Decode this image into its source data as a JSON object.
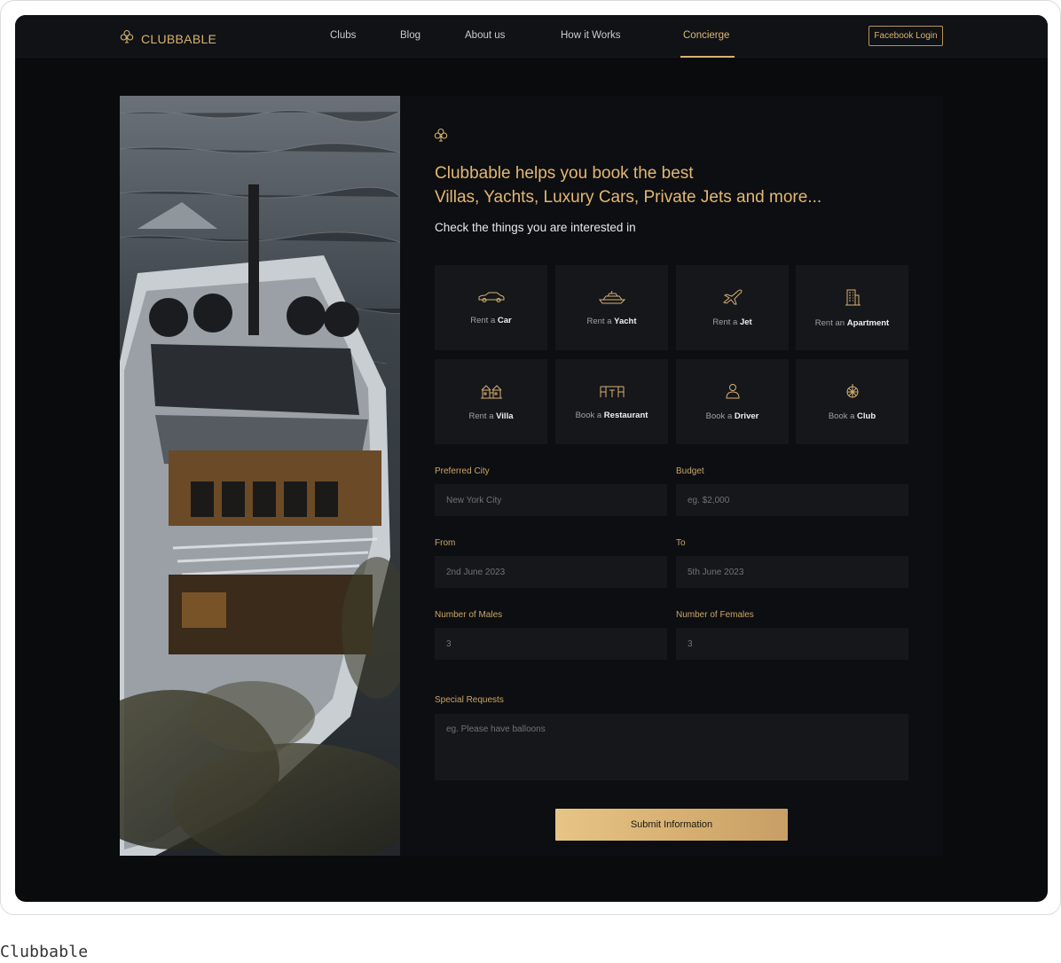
{
  "header": {
    "logo_text": "CLUBBABLE",
    "nav": [
      {
        "label": "Clubs"
      },
      {
        "label": "Blog"
      },
      {
        "label": "About us"
      },
      {
        "label": "How it Works"
      },
      {
        "label": "Concierge",
        "active": true
      }
    ],
    "facebook_login_label": "Facebook Login"
  },
  "panel": {
    "headline_line1": "Clubbable helps you book the best",
    "headline_line2": "Villas, Yachts, Luxury Cars, Private Jets and more...",
    "subline": "Check the things you are interested in",
    "tiles": [
      {
        "prefix": "Rent a",
        "item": "Car",
        "icon": "car-icon"
      },
      {
        "prefix": "Rent a",
        "item": "Yacht",
        "icon": "yacht-icon"
      },
      {
        "prefix": "Rent a",
        "item": "Jet",
        "icon": "jet-icon"
      },
      {
        "prefix": "Rent an",
        "item": "Apartment",
        "icon": "apartment-icon"
      },
      {
        "prefix": "Rent a",
        "item": "Villa",
        "icon": "villa-icon"
      },
      {
        "prefix": "Book a",
        "item": "Restaurant",
        "icon": "restaurant-icon"
      },
      {
        "prefix": "Book a",
        "item": "Driver",
        "icon": "driver-icon"
      },
      {
        "prefix": "Book a",
        "item": "Club",
        "icon": "club-icon"
      }
    ],
    "form": {
      "city_label": "Preferred City",
      "city_placeholder": "New York City",
      "budget_label": "Budget",
      "budget_placeholder": "eg. $2,000",
      "from_label": "From",
      "from_placeholder": "2nd June 2023",
      "to_label": "To",
      "to_placeholder": "5th June 2023",
      "males_label": "Number of Males",
      "males_placeholder": "3",
      "females_label": "Number of Females",
      "females_placeholder": "3",
      "requests_label": "Special Requests",
      "requests_placeholder": "eg. Please have balloons",
      "submit_label": "Submit Information"
    }
  },
  "caption": "Clubbable",
  "colors": {
    "accent": "#d9b26f",
    "background": "#0a0b0d",
    "tile": "#15171b"
  }
}
